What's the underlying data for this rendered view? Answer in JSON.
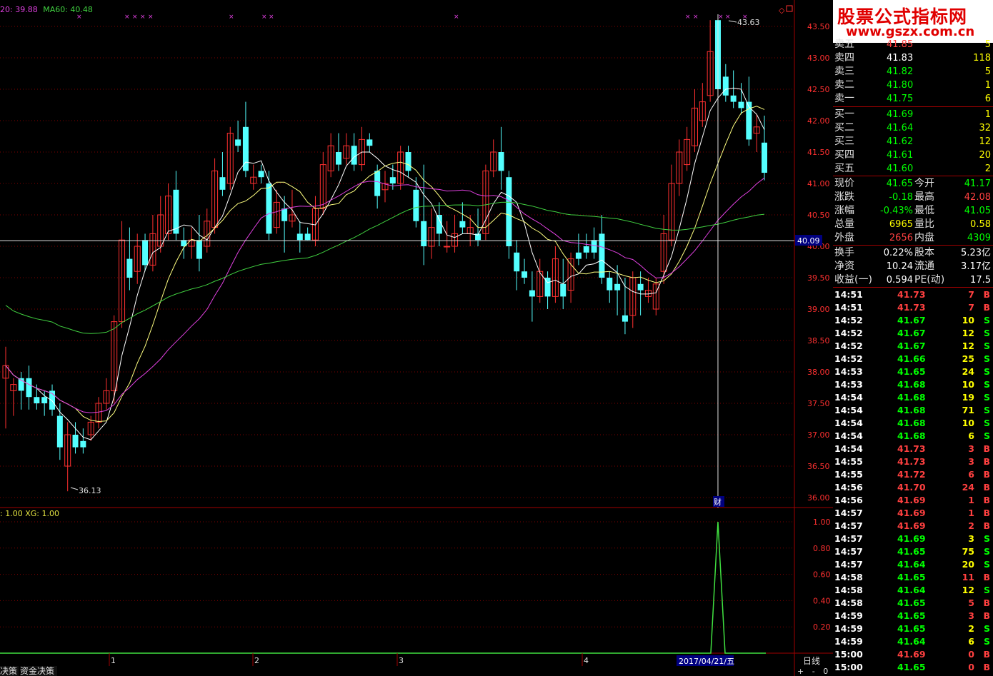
{
  "top_legend": {
    "ma20": "20: 39.88",
    "ma60": "MA60: 40.48"
  },
  "sub_legend": ": 1.00  XG: 1.00",
  "price_axis": [
    "43.50",
    "43.00",
    "42.50",
    "42.00",
    "41.50",
    "41.00",
    "40.50",
    "40.00",
    "39.50",
    "39.00",
    "38.50",
    "38.00",
    "37.50",
    "37.00",
    "36.50",
    "36.00"
  ],
  "sub_axis": [
    "1.00",
    "0.80",
    "0.60",
    "0.40",
    "0.20"
  ],
  "crosshair_price": "40.09",
  "high_label": "43.63",
  "low_label": "36.13",
  "cai_label": "财",
  "date_label": "2017/04/21/五",
  "period_label": "日线",
  "month_labels": [
    "1",
    "2",
    "3",
    "4"
  ],
  "bottom_tabs": [
    "决策",
    "资金决策"
  ],
  "zoom_buttons": [
    "+",
    "-",
    "0"
  ],
  "logo": {
    "line1": "股票公式指标网",
    "line2": "www.gszx.com.cn"
  },
  "order_book": [
    {
      "label": "卖五",
      "price": "41.85",
      "vol": "5",
      "pc": "red",
      "vc": "yel"
    },
    {
      "label": "卖四",
      "price": "41.83",
      "vol": "118",
      "pc": "wht",
      "vc": "yel"
    },
    {
      "label": "卖三",
      "price": "41.82",
      "vol": "5",
      "pc": "grn",
      "vc": "yel"
    },
    {
      "label": "卖二",
      "price": "41.80",
      "vol": "1",
      "pc": "grn",
      "vc": "yel"
    },
    {
      "label": "卖一",
      "price": "41.75",
      "vol": "6",
      "pc": "grn",
      "vc": "yel"
    },
    {
      "label": "买一",
      "price": "41.69",
      "vol": "1",
      "pc": "grn",
      "vc": "yel"
    },
    {
      "label": "买二",
      "price": "41.64",
      "vol": "32",
      "pc": "grn",
      "vc": "yel"
    },
    {
      "label": "买三",
      "price": "41.62",
      "vol": "12",
      "pc": "grn",
      "vc": "yel"
    },
    {
      "label": "买四",
      "price": "41.61",
      "vol": "20",
      "pc": "grn",
      "vc": "yel"
    },
    {
      "label": "买五",
      "price": "41.60",
      "vol": "2",
      "pc": "grn",
      "vc": "yel"
    }
  ],
  "stats": [
    {
      "l1": "现价",
      "v1": "41.65",
      "c1": "grn",
      "l2": "今开",
      "v2": "41.17",
      "c2": "grn"
    },
    {
      "l1": "涨跌",
      "v1": "-0.18",
      "c1": "grn",
      "l2": "最高",
      "v2": "42.08",
      "c2": "red"
    },
    {
      "l1": "涨幅",
      "v1": "-0.43%",
      "c1": "grn",
      "l2": "最低",
      "v2": "41.05",
      "c2": "grn"
    },
    {
      "l1": "总量",
      "v1": "6965",
      "c1": "yel",
      "l2": "量比",
      "v2": "0.58",
      "c2": "yel"
    },
    {
      "l1": "外盘",
      "v1": "2656",
      "c1": "red",
      "l2": "内盘",
      "v2": "4309",
      "c2": "grn"
    },
    {
      "l1": "换手",
      "v1": "0.22%",
      "c1": "wht",
      "l2": "股本",
      "v2": "5.23亿",
      "c2": "wht"
    },
    {
      "l1": "净资",
      "v1": "10.24",
      "c1": "wht",
      "l2": "流通",
      "v2": "3.17亿",
      "c2": "wht"
    },
    {
      "l1": "收益(一)",
      "v1": "0.594",
      "c1": "wht",
      "l2": "PE(动)",
      "v2": "17.5",
      "c2": "wht"
    }
  ],
  "ticks": [
    [
      "14:51",
      "41.73",
      "7",
      "B"
    ],
    [
      "14:51",
      "41.73",
      "7",
      "B"
    ],
    [
      "14:52",
      "41.67",
      "10",
      "S"
    ],
    [
      "14:52",
      "41.67",
      "12",
      "S"
    ],
    [
      "14:52",
      "41.67",
      "12",
      "S"
    ],
    [
      "14:52",
      "41.66",
      "25",
      "S"
    ],
    [
      "14:53",
      "41.65",
      "24",
      "S"
    ],
    [
      "14:53",
      "41.68",
      "10",
      "S"
    ],
    [
      "14:54",
      "41.68",
      "19",
      "S"
    ],
    [
      "14:54",
      "41.68",
      "71",
      "S"
    ],
    [
      "14:54",
      "41.68",
      "10",
      "S"
    ],
    [
      "14:54",
      "41.68",
      "6",
      "S"
    ],
    [
      "14:54",
      "41.73",
      "3",
      "B"
    ],
    [
      "14:55",
      "41.73",
      "3",
      "B"
    ],
    [
      "14:55",
      "41.72",
      "6",
      "B"
    ],
    [
      "14:56",
      "41.70",
      "24",
      "B"
    ],
    [
      "14:56",
      "41.69",
      "1",
      "B"
    ],
    [
      "14:57",
      "41.69",
      "1",
      "B"
    ],
    [
      "14:57",
      "41.69",
      "2",
      "B"
    ],
    [
      "14:57",
      "41.69",
      "3",
      "S"
    ],
    [
      "14:57",
      "41.65",
      "75",
      "S"
    ],
    [
      "14:57",
      "41.64",
      "20",
      "S"
    ],
    [
      "14:58",
      "41.65",
      "11",
      "B"
    ],
    [
      "14:58",
      "41.64",
      "12",
      "S"
    ],
    [
      "14:58",
      "41.65",
      "5",
      "B"
    ],
    [
      "14:59",
      "41.65",
      "3",
      "B"
    ],
    [
      "14:59",
      "41.65",
      "2",
      "S"
    ],
    [
      "14:59",
      "41.64",
      "6",
      "S"
    ],
    [
      "15:00",
      "41.69",
      "0",
      "B"
    ],
    [
      "15:00",
      "41.65",
      "0",
      "B"
    ]
  ],
  "chart_data": {
    "type": "candlestick",
    "ylim": [
      35.8,
      43.8
    ],
    "candles": [
      {
        "o": 37.9,
        "h": 38.4,
        "c": 38.1,
        "l": 37.1
      },
      {
        "o": 37.7,
        "h": 37.9,
        "c": 37.8,
        "l": 37.3
      },
      {
        "o": 37.9,
        "h": 38.0,
        "c": 37.7,
        "l": 37.4
      },
      {
        "o": 37.9,
        "h": 38.1,
        "c": 37.6,
        "l": 37.4
      },
      {
        "o": 37.6,
        "h": 37.8,
        "c": 37.5,
        "l": 37.4
      },
      {
        "o": 37.6,
        "h": 37.7,
        "c": 37.5,
        "l": 37.3
      },
      {
        "o": 37.7,
        "h": 37.8,
        "c": 37.4,
        "l": 37.3
      },
      {
        "o": 37.3,
        "h": 37.5,
        "c": 36.8,
        "l": 36.6
      },
      {
        "o": 36.5,
        "h": 37.2,
        "c": 37.0,
        "l": 36.1
      },
      {
        "o": 37.0,
        "h": 37.2,
        "c": 36.8,
        "l": 36.7
      },
      {
        "o": 36.9,
        "h": 37.1,
        "c": 36.8,
        "l": 36.7
      },
      {
        "o": 37.0,
        "h": 37.3,
        "c": 37.2,
        "l": 36.9
      },
      {
        "o": 37.2,
        "h": 37.6,
        "c": 37.5,
        "l": 37.1
      },
      {
        "o": 37.5,
        "h": 37.9,
        "c": 37.7,
        "l": 37.4
      },
      {
        "o": 37.7,
        "h": 38.9,
        "c": 38.8,
        "l": 37.5
      },
      {
        "o": 38.8,
        "h": 40.4,
        "c": 40.1,
        "l": 38.7
      },
      {
        "o": 39.8,
        "h": 40.3,
        "c": 39.5,
        "l": 39.3
      },
      {
        "o": 39.6,
        "h": 40.2,
        "c": 40.0,
        "l": 39.4
      },
      {
        "o": 40.1,
        "h": 40.2,
        "c": 39.7,
        "l": 39.6
      },
      {
        "o": 39.7,
        "h": 40.5,
        "c": 40.2,
        "l": 39.6
      },
      {
        "o": 40.0,
        "h": 40.8,
        "c": 40.5,
        "l": 39.9
      },
      {
        "o": 40.2,
        "h": 41.0,
        "c": 40.8,
        "l": 40.1
      },
      {
        "o": 40.9,
        "h": 41.2,
        "c": 40.2,
        "l": 40.1
      },
      {
        "o": 40.1,
        "h": 40.3,
        "c": 40.0,
        "l": 39.8
      },
      {
        "o": 40.0,
        "h": 40.3,
        "c": 40.1,
        "l": 39.8
      },
      {
        "o": 40.1,
        "h": 40.5,
        "c": 39.8,
        "l": 39.6
      },
      {
        "o": 40.0,
        "h": 40.6,
        "c": 40.4,
        "l": 39.9
      },
      {
        "o": 40.3,
        "h": 41.4,
        "c": 41.2,
        "l": 40.2
      },
      {
        "o": 41.1,
        "h": 41.5,
        "c": 40.9,
        "l": 40.8
      },
      {
        "o": 41.0,
        "h": 41.9,
        "c": 41.8,
        "l": 40.9
      },
      {
        "o": 41.7,
        "h": 42.0,
        "c": 41.6,
        "l": 41.5
      },
      {
        "o": 41.9,
        "h": 42.3,
        "c": 41.2,
        "l": 41.1
      },
      {
        "o": 41.0,
        "h": 41.3,
        "c": 41.1,
        "l": 40.9
      },
      {
        "o": 41.2,
        "h": 41.3,
        "c": 41.1,
        "l": 41.0
      },
      {
        "o": 41.0,
        "h": 41.2,
        "c": 40.2,
        "l": 40.1
      },
      {
        "o": 40.3,
        "h": 40.9,
        "c": 40.7,
        "l": 40.2
      },
      {
        "o": 40.6,
        "h": 40.8,
        "c": 40.4,
        "l": 39.9
      },
      {
        "o": 40.4,
        "h": 40.9,
        "c": 40.5,
        "l": 40.3
      },
      {
        "o": 40.2,
        "h": 40.4,
        "c": 40.1,
        "l": 39.9
      },
      {
        "o": 40.2,
        "h": 40.3,
        "c": 40.1,
        "l": 40.1
      },
      {
        "o": 40.1,
        "h": 40.8,
        "c": 40.6,
        "l": 40.0
      },
      {
        "o": 40.6,
        "h": 41.5,
        "c": 41.3,
        "l": 40.5
      },
      {
        "o": 41.2,
        "h": 41.8,
        "c": 41.6,
        "l": 41.1
      },
      {
        "o": 41.5,
        "h": 41.8,
        "c": 41.3,
        "l": 41.2
      },
      {
        "o": 41.4,
        "h": 41.8,
        "c": 41.6,
        "l": 41.3
      },
      {
        "o": 41.6,
        "h": 41.8,
        "c": 41.3,
        "l": 41.2
      },
      {
        "o": 41.3,
        "h": 41.9,
        "c": 41.7,
        "l": 41.2
      },
      {
        "o": 41.7,
        "h": 41.8,
        "c": 41.6,
        "l": 41.5
      },
      {
        "o": 41.2,
        "h": 41.3,
        "c": 40.8,
        "l": 40.6
      },
      {
        "o": 40.9,
        "h": 41.2,
        "c": 41.0,
        "l": 40.7
      },
      {
        "o": 41.1,
        "h": 41.3,
        "c": 41.0,
        "l": 40.9
      },
      {
        "o": 41.0,
        "h": 41.6,
        "c": 41.5,
        "l": 40.9
      },
      {
        "o": 41.5,
        "h": 41.6,
        "c": 41.2,
        "l": 41.1
      },
      {
        "o": 40.9,
        "h": 41.1,
        "c": 40.4,
        "l": 40.3
      },
      {
        "o": 40.4,
        "h": 41.3,
        "c": 40.0,
        "l": 39.7
      },
      {
        "o": 40.0,
        "h": 40.6,
        "c": 40.3,
        "l": 39.8
      },
      {
        "o": 40.5,
        "h": 40.7,
        "c": 40.2,
        "l": 40.0
      },
      {
        "o": 40.0,
        "h": 40.4,
        "c": 40.0,
        "l": 39.9
      },
      {
        "o": 40.0,
        "h": 40.5,
        "c": 40.2,
        "l": 39.9
      },
      {
        "o": 40.4,
        "h": 40.7,
        "c": 40.3,
        "l": 40.2
      },
      {
        "o": 40.2,
        "h": 40.5,
        "c": 40.3,
        "l": 40.0
      },
      {
        "o": 40.2,
        "h": 40.6,
        "c": 40.1,
        "l": 40.0
      },
      {
        "o": 40.2,
        "h": 41.3,
        "c": 41.2,
        "l": 40.1
      },
      {
        "o": 41.2,
        "h": 41.7,
        "c": 41.5,
        "l": 41.1
      },
      {
        "o": 41.5,
        "h": 41.9,
        "c": 41.2,
        "l": 40.9
      },
      {
        "o": 41.1,
        "h": 41.2,
        "c": 40.0,
        "l": 39.8
      },
      {
        "o": 39.9,
        "h": 40.1,
        "c": 39.6,
        "l": 39.3
      },
      {
        "o": 39.6,
        "h": 39.8,
        "c": 39.5,
        "l": 39.4
      },
      {
        "o": 39.3,
        "h": 39.6,
        "c": 39.2,
        "l": 38.8
      },
      {
        "o": 39.2,
        "h": 39.8,
        "c": 39.6,
        "l": 39.1
      },
      {
        "o": 39.5,
        "h": 39.6,
        "c": 39.2,
        "l": 39.0
      },
      {
        "o": 39.2,
        "h": 40.0,
        "c": 39.8,
        "l": 39.1
      },
      {
        "o": 39.4,
        "h": 39.8,
        "c": 39.2,
        "l": 39.0
      },
      {
        "o": 39.3,
        "h": 39.9,
        "c": 39.8,
        "l": 39.1
      },
      {
        "o": 39.9,
        "h": 40.2,
        "c": 39.8,
        "l": 39.7
      },
      {
        "o": 40.0,
        "h": 40.2,
        "c": 39.9,
        "l": 39.8
      },
      {
        "o": 40.1,
        "h": 40.3,
        "c": 39.9,
        "l": 39.8
      },
      {
        "o": 40.2,
        "h": 40.5,
        "c": 39.5,
        "l": 39.4
      },
      {
        "o": 39.5,
        "h": 39.6,
        "c": 39.3,
        "l": 39.1
      },
      {
        "o": 39.4,
        "h": 39.7,
        "c": 39.3,
        "l": 38.9
      },
      {
        "o": 38.9,
        "h": 39.5,
        "c": 38.8,
        "l": 38.6
      },
      {
        "o": 38.9,
        "h": 39.6,
        "c": 39.5,
        "l": 38.7
      },
      {
        "o": 39.4,
        "h": 39.6,
        "c": 39.3,
        "l": 38.9
      },
      {
        "o": 39.2,
        "h": 39.5,
        "c": 39.3,
        "l": 39.1
      },
      {
        "o": 39.0,
        "h": 39.5,
        "c": 39.4,
        "l": 38.9
      },
      {
        "o": 39.6,
        "h": 40.5,
        "c": 40.2,
        "l": 39.4
      },
      {
        "o": 40.1,
        "h": 41.3,
        "c": 41.0,
        "l": 40.0
      },
      {
        "o": 41.0,
        "h": 41.7,
        "c": 41.5,
        "l": 40.8
      },
      {
        "o": 41.3,
        "h": 41.9,
        "c": 41.7,
        "l": 41.2
      },
      {
        "o": 41.6,
        "h": 42.5,
        "c": 42.2,
        "l": 41.5
      },
      {
        "o": 42.0,
        "h": 42.6,
        "c": 42.3,
        "l": 41.9
      },
      {
        "o": 42.4,
        "h": 43.6,
        "c": 43.1,
        "l": 42.3
      },
      {
        "o": 43.6,
        "h": 43.63,
        "c": 42.5,
        "l": 42.4
      },
      {
        "o": 42.7,
        "h": 42.9,
        "c": 42.4,
        "l": 42.3
      },
      {
        "o": 42.4,
        "h": 42.8,
        "c": 42.3,
        "l": 42.2
      },
      {
        "o": 42.3,
        "h": 42.6,
        "c": 42.2,
        "l": 42.1
      },
      {
        "o": 42.3,
        "h": 42.7,
        "c": 41.7,
        "l": 41.6
      },
      {
        "o": 41.8,
        "h": 42.1,
        "c": 41.9,
        "l": 41.5
      },
      {
        "o": 41.65,
        "h": 42.08,
        "c": 41.17,
        "l": 41.05
      }
    ],
    "ma_series": [
      {
        "name": "20",
        "color": "#e040e0"
      },
      {
        "name": "MA60",
        "color": "#40d040"
      }
    ],
    "sub_chart": {
      "name": "XG",
      "signal_index": 95,
      "ylim": [
        0,
        1.1
      ]
    }
  }
}
